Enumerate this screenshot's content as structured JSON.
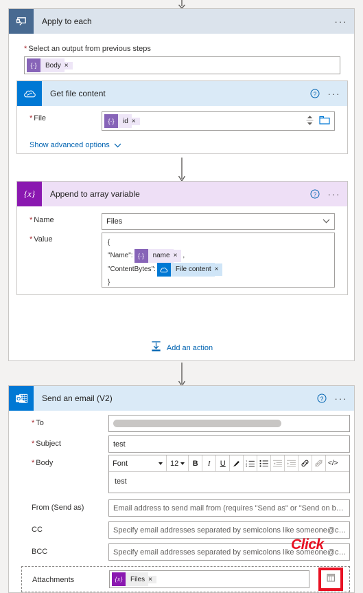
{
  "colors": {
    "accent_blue": "#0078d4",
    "loop_header": "#dbe3ec",
    "loop_icon": "#486a91",
    "connector_blue": "#daeaf7",
    "variable_purple": "#8a18b0",
    "variable_header": "#eedff6",
    "token_violet": "#8764b8",
    "required_red": "#a4262c",
    "highlight_red": "#e81123",
    "link_blue": "#0063b1",
    "page_bg": "#f3f2f1"
  },
  "apply_to_each": {
    "title": "Apply to each",
    "icon": "foreach-loop-icon",
    "ellipsis": "···",
    "output_label": "Select an output from previous steps",
    "output_token": {
      "icon": "expression-icon",
      "glyph": "{·}",
      "label": "Body",
      "remove": "×"
    },
    "add_action_label": "Add an action"
  },
  "get_file_content": {
    "title": "Get file content",
    "icon": "onedrive-cloud-icon",
    "help": "?",
    "ellipsis": "···",
    "file_label": "File",
    "file_token": {
      "icon": "expression-icon",
      "glyph": "{·}",
      "label": "id",
      "remove": "×"
    },
    "show_advanced_label": "Show advanced options"
  },
  "append_to_array": {
    "title": "Append to array variable",
    "icon": "variable-braces-icon",
    "icon_glyph": "{x}",
    "help": "?",
    "ellipsis": "···",
    "name_label": "Name",
    "name_value": "Files",
    "value_label": "Value",
    "value_lines": {
      "open_brace": "{",
      "name_key": "\"Name\":",
      "name_token": {
        "icon": "expression-icon",
        "glyph": "{·}",
        "label": "name",
        "remove": "×"
      },
      "comma": ",",
      "content_key": "\"ContentBytes\":",
      "content_token": {
        "icon": "onedrive-cloud-icon",
        "label": "File content",
        "remove": "×"
      },
      "close_brace": "}"
    }
  },
  "send_email": {
    "title": "Send an email (V2)",
    "icon": "outlook-icon",
    "help": "?",
    "ellipsis": "···",
    "to_label": "To",
    "to_value": "",
    "subject_label": "Subject",
    "subject_value": "test",
    "body_label": "Body",
    "body_value": "test",
    "toolbar": {
      "font_name": "Font",
      "font_size": "12",
      "bold": "B",
      "italic": "I",
      "underline": "U",
      "highlight": "highlighter-icon",
      "numbered_list": "numbered-list-icon",
      "bulleted_list": "bulleted-list-icon",
      "outdent": "outdent-icon",
      "indent": "indent-icon",
      "link": "link-icon",
      "unlink": "unlink-icon",
      "code": "</>"
    },
    "from_label": "From (Send as)",
    "from_placeholder": "Email address to send mail from (requires \"Send as\" or \"Send on b…",
    "cc_label": "CC",
    "cc_placeholder": "Specify email addresses separated by semicolons like someone@c…",
    "bcc_label": "BCC",
    "bcc_placeholder": "Specify email addresses separated by semicolons like someone@c…",
    "attachments_label": "Attachments",
    "attachments_token": {
      "icon": "variable-braces-icon",
      "glyph": "{x}",
      "label": "Files",
      "remove": "×"
    },
    "attachments_action_icon": "add-dynamic-content-icon"
  },
  "annotation": {
    "click_label": "Click"
  }
}
